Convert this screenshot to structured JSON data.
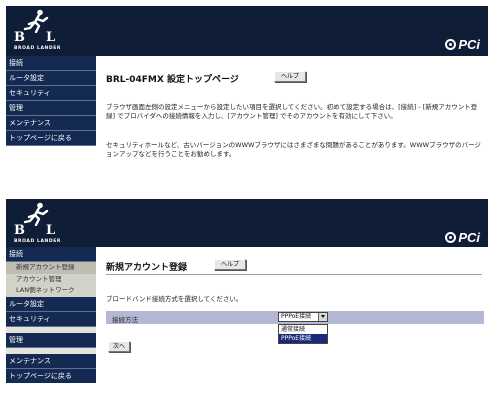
{
  "colors": {
    "header": "#0f1d36",
    "nav": "#152a52",
    "subnav": "#d2d2c8",
    "form_row": "#b4b8d4",
    "selected": "#1a2a7a"
  },
  "icons": {
    "logo": "running-man-logo",
    "brand_mark": "pci-circle-mark"
  },
  "logo": {
    "letter_left": "B",
    "letter_right": "L",
    "tagline": "BROAD LANDER"
  },
  "brand": {
    "name": "PCi"
  },
  "top": {
    "nav": [
      "接続",
      "ルータ設定",
      "セキュリティ",
      "管理",
      "メンテナンス",
      "トップページに戻る"
    ],
    "heading": "BRL-04FMX 設定トップページ",
    "help_label": "ヘルプ",
    "para1": "ブラウザ画面左側の設定メニューから設定したい項目を選択してください。初めて設定する場合は、[接続] - [新規アカウント登録] でプロバイダへの接続情報を入力し、[アカウント管理] でそのアカウントを有効にして下さい。",
    "para2": "セキュリティホールなど、古いバージョンのWWWブラウザにはさまざまな問題があることがあります。WWWブラウザのバージョンアップなどを行うことをお勧めします。"
  },
  "bottom": {
    "nav_connect": "接続",
    "subnav": [
      "新規アカウント登録",
      "アカウント管理",
      "LAN側ネットワーク"
    ],
    "nav_rest": [
      "ルータ設定",
      "セキュリティ",
      "管理",
      "メンテナンス",
      "トップページに戻る"
    ],
    "heading": "新規アカウント登録",
    "help_label": "ヘルプ",
    "intro": "ブロードバンド接続方式を選択してください。",
    "field_label": "接続方法",
    "select_value": "PPPoE接続",
    "options": [
      "通常接続",
      "PPPoE接続"
    ],
    "next_label": "次へ"
  }
}
